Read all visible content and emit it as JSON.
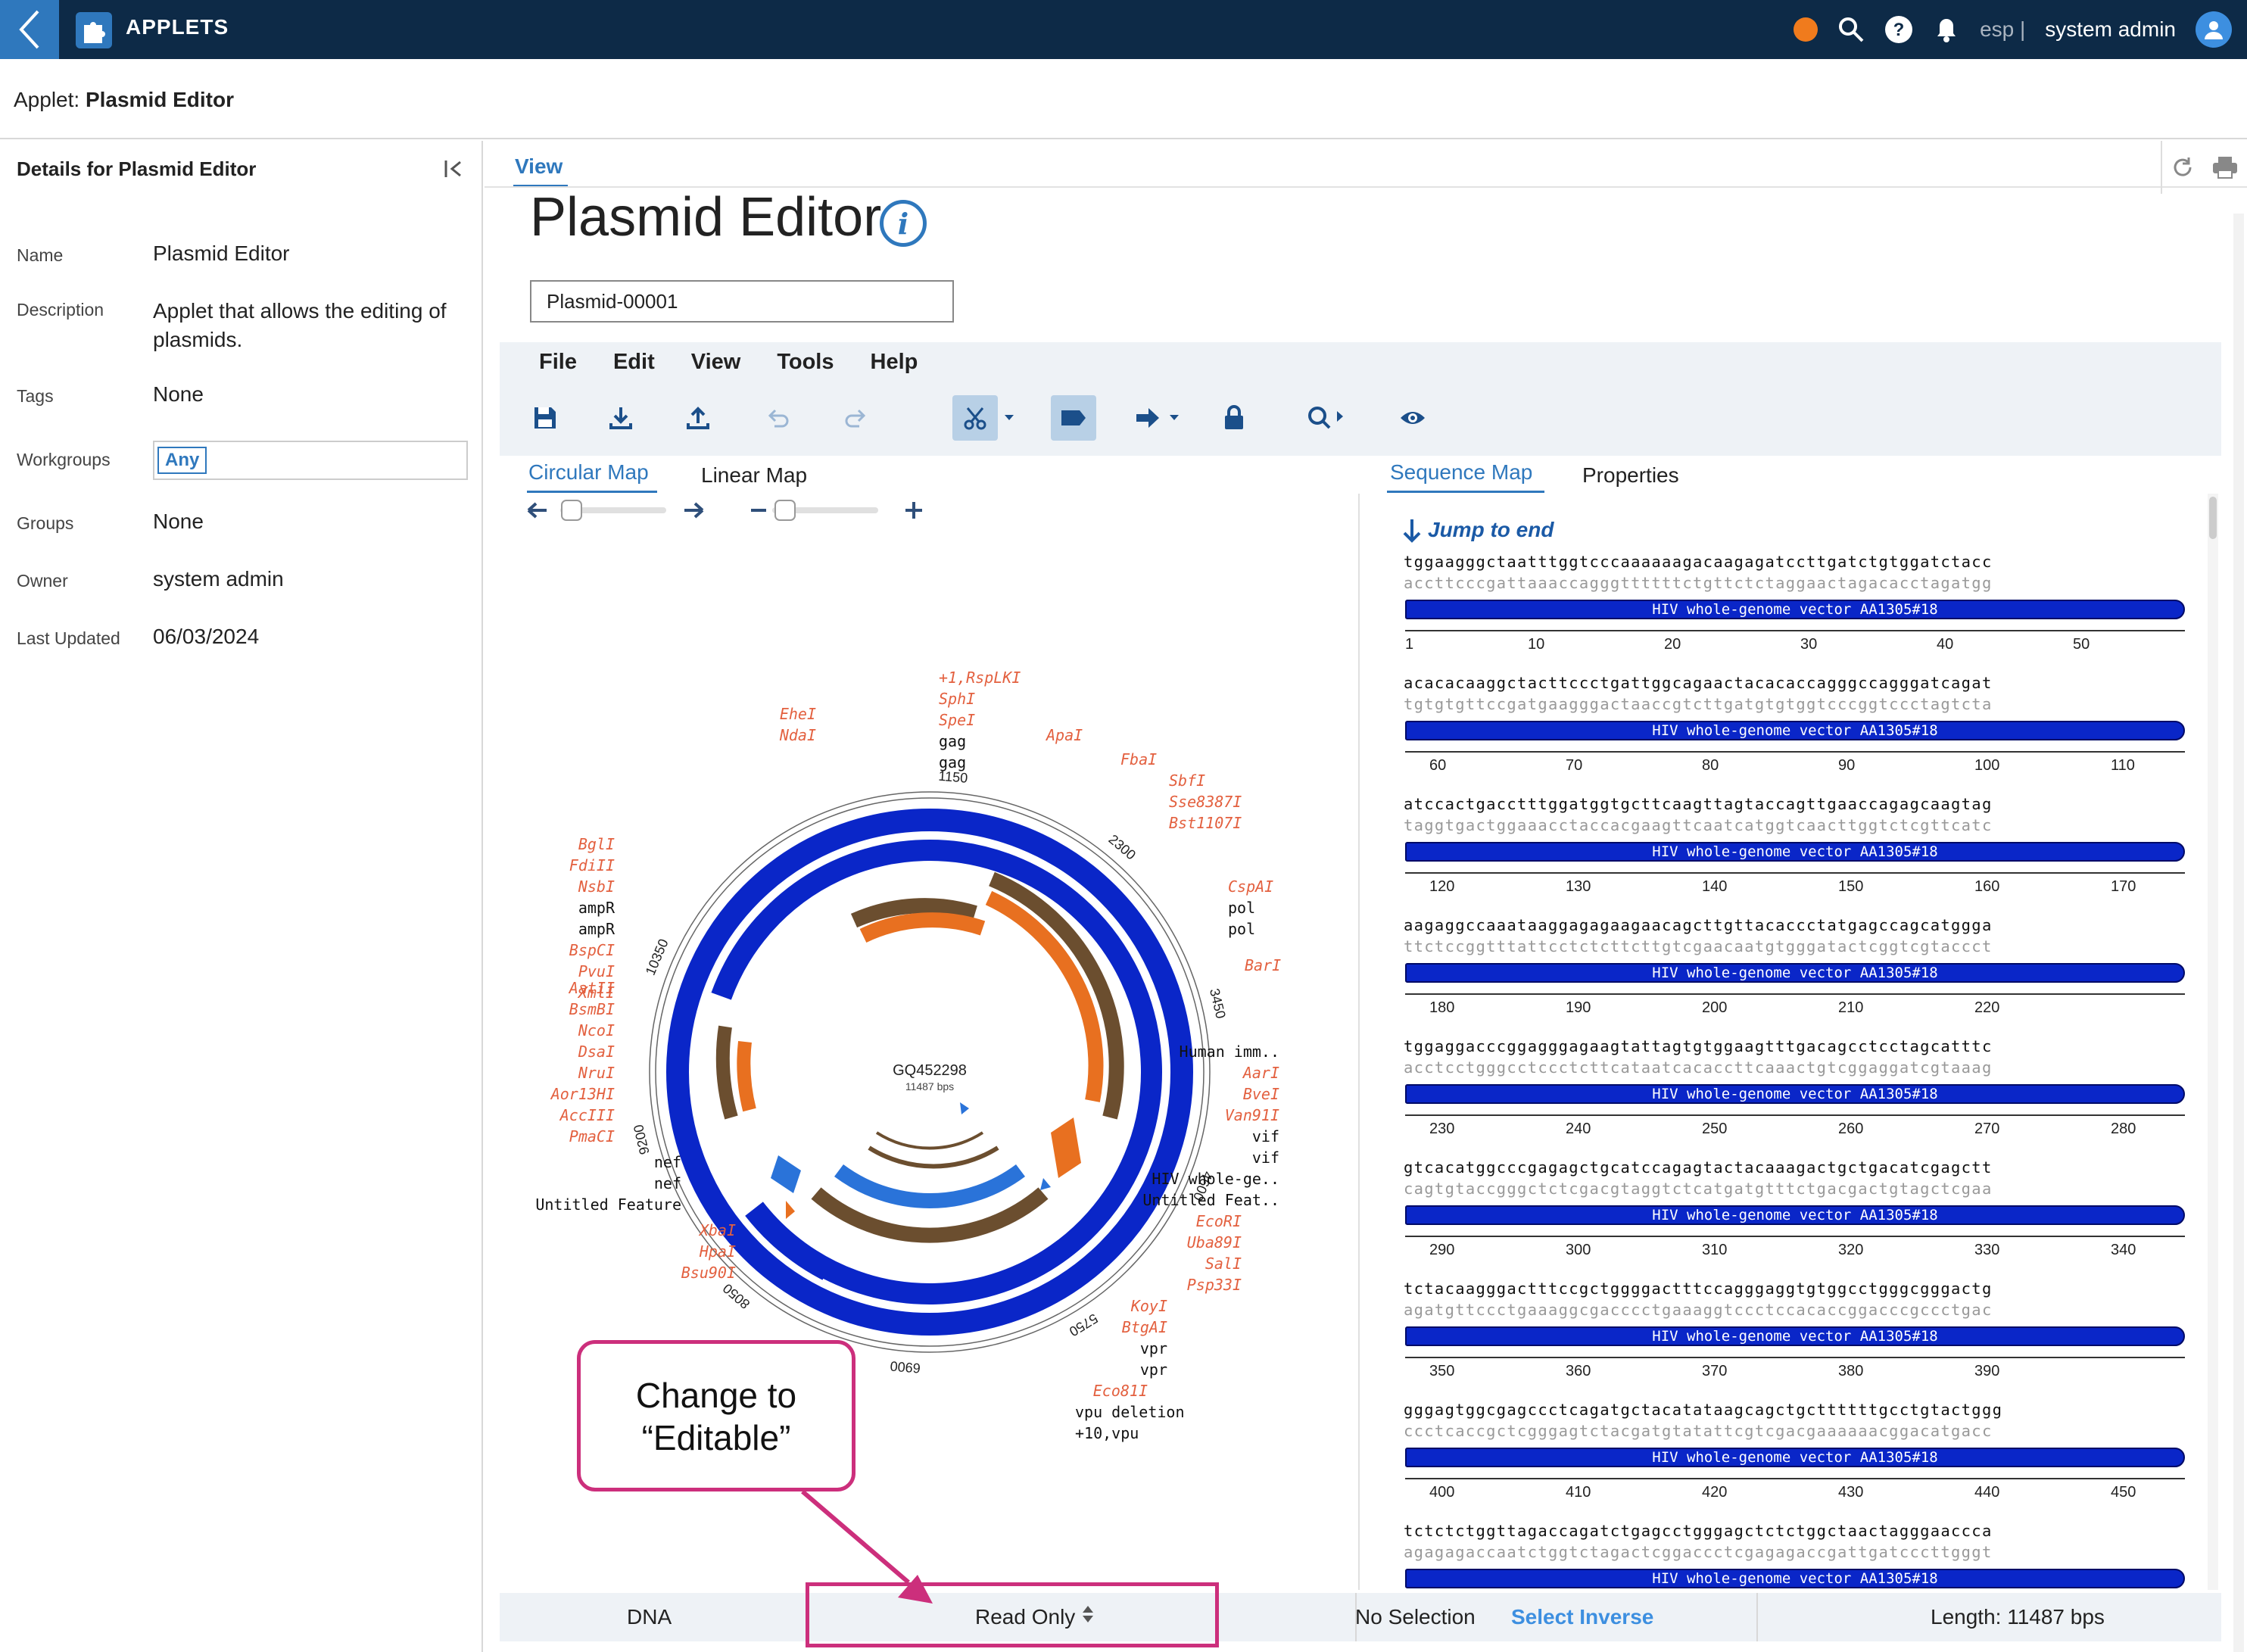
{
  "topbar": {
    "app_title": "APPLETS",
    "lang": "esp |",
    "user": "system admin"
  },
  "applet_bar": {
    "prefix": "Applet:",
    "name": "Plasmid Editor"
  },
  "sidebar": {
    "title": "Details for Plasmid Editor",
    "rows": {
      "name": {
        "label": "Name",
        "value": "Plasmid Editor"
      },
      "description": {
        "label": "Description",
        "value": "Applet that allows the editing of plasmids."
      },
      "tags": {
        "label": "Tags",
        "value": "None"
      },
      "workgroups": {
        "label": "Workgroups",
        "value": "Any"
      },
      "groups": {
        "label": "Groups",
        "value": "None"
      },
      "owner": {
        "label": "Owner",
        "value": "system admin"
      },
      "updated": {
        "label": "Last Updated",
        "value": "06/03/2024"
      }
    }
  },
  "main": {
    "view_tab": "View",
    "page_title": "Plasmid Editor",
    "name_input": "Plasmid-00001"
  },
  "editor": {
    "menu": {
      "file": "File",
      "edit": "Edit",
      "view": "View",
      "tools": "Tools",
      "help": "Help"
    },
    "left_tabs": {
      "circular": "Circular Map",
      "linear": "Linear Map"
    },
    "right_tabs": {
      "sequence": "Sequence Map",
      "properties": "Properties"
    },
    "plasmid": {
      "name": "GQ452298",
      "length": "11487 bps"
    },
    "ruler": [
      "1150",
      "2300",
      "3450",
      "4600",
      "5750",
      "6900",
      "8050",
      "9200",
      "10350"
    ],
    "enzymes_left": [
      "BglI",
      "FdiII",
      "NsbI",
      "ampR",
      "ampR",
      "BspCI",
      "PvuI",
      "XmlI",
      "AatII",
      "BsmBI",
      "NcoI",
      "DsaI",
      "NruI",
      "Aor13HI",
      "AccIII",
      "PmaCI",
      "nef",
      "nef",
      "Untitled Feature",
      "XbaI",
      "HpaI",
      "Bsu90I"
    ],
    "enzymes_top": [
      "+1,RspLKI",
      "SphI",
      "SpeI",
      "gag",
      "gag",
      "EheI",
      "NdaI",
      "ApaI",
      "FbaI",
      "SbfI",
      "Sse8387I",
      "Bst1107I",
      "CspAI",
      "pol",
      "pol",
      "BarI"
    ],
    "enzymes_right": [
      "Human imm..",
      "AarI",
      "BveI",
      "Van91I",
      "vif",
      "vif",
      "HIV whole-ge..",
      "Untitled Feat..",
      "EcoRI",
      "Uba89I",
      "SalI",
      "Psp33I",
      "KoyI",
      "BtgAI",
      "vpr",
      "vpr",
      "Eco81I",
      "vpu deletion",
      "+10,vpu"
    ],
    "jump": "Jump to end",
    "feature_label": "HIV whole-genome vector AA1305#18",
    "seq_rows": [
      {
        "fwd": "tggaagggctaatttggtcccaaaaaagacaagagatccttgatctgtggatctacc",
        "rev": "accttcccgattaaaccagggttttttctgttctctaggaactagacacctagatgg",
        "nums": [
          "1",
          "10",
          "20",
          "30",
          "40",
          "50"
        ]
      },
      {
        "fwd": "acacacaaggctacttccctgattggcagaactacacaccagggccagggatcagat",
        "rev": "tgtgtgttccgatgaagggactaaccgtcttgatgtgtggtcccggtccctagtcta",
        "nums": [
          "60",
          "70",
          "80",
          "90",
          "100",
          "110"
        ]
      },
      {
        "fwd": "atccactgacctttggatggtgcttcaagttagtaccagttgaaccagagcaagtag",
        "rev": "taggtgactggaaacctaccacgaagttcaatcatggtcaacttggtctcgttcatc",
        "nums": [
          "120",
          "130",
          "140",
          "150",
          "160",
          "170"
        ]
      },
      {
        "fwd": "aagaggccaaataaggagagaagaacagcttgttacaccctatgagccagcatggga",
        "rev": "ttctccggtttattcctctcttcttgtcgaacaatgtgggatactcggtcgtaccct",
        "nums": [
          "180",
          "190",
          "200",
          "210",
          "220"
        ]
      },
      {
        "fwd": "tggaggacccggagggagaagtattagtgtggaagtttgacagcctcctagcatttc",
        "rev": "acctcctgggcctccctcttcataatcacaccttcaaactgtcggaggatcgtaaag",
        "nums": [
          "230",
          "240",
          "250",
          "260",
          "270",
          "280"
        ]
      },
      {
        "fwd": "gtcacatggcccgagagctgcatccagagtactacaaagactgctgacatcgagctt",
        "rev": "cagtgtaccgggctctcgacgtaggtctcatgatgtttctgacgactgtagctcgaa",
        "nums": [
          "290",
          "300",
          "310",
          "320",
          "330",
          "340"
        ]
      },
      {
        "fwd": "tctacaagggactttccgctggggactttccagggaggtgtggcctgggcgggactg",
        "rev": "agatgttccctgaaaggcgacccctgaaaggtccctccacaccggacccgccctgac",
        "nums": [
          "350",
          "360",
          "370",
          "380",
          "390"
        ]
      },
      {
        "fwd": "gggagtggcgagccctcagatgctacatataagcagctgcttttttgcctgtactggg",
        "rev": "ccctcaccgctcgggagtctacgatgtatattcgtcgacgaaaaaacggacatgacc",
        "nums": [
          "400",
          "410",
          "420",
          "430",
          "440",
          "450"
        ]
      },
      {
        "fwd": "tctctctggttagaccagatctgagcctgggagctctctggctaactagggaaccca",
        "rev": "agagagaccaatctggtctagactcggaccctcgagagaccgattgatcccttgggt",
        "nums": []
      }
    ],
    "status": {
      "type": "DNA",
      "mode": "Read Only",
      "selection": "No Selection",
      "select_inverse": "Select Inverse",
      "length": "Length: 11487 bps"
    }
  },
  "annotation": {
    "callout_line1": "Change to",
    "callout_line2": "“Editable”"
  },
  "colors": {
    "nav": "#0d2a47",
    "accent": "#2f78bd",
    "feature": "#0a26c8",
    "callout": "#cc2f7c",
    "enzyme": "#e3603f"
  }
}
